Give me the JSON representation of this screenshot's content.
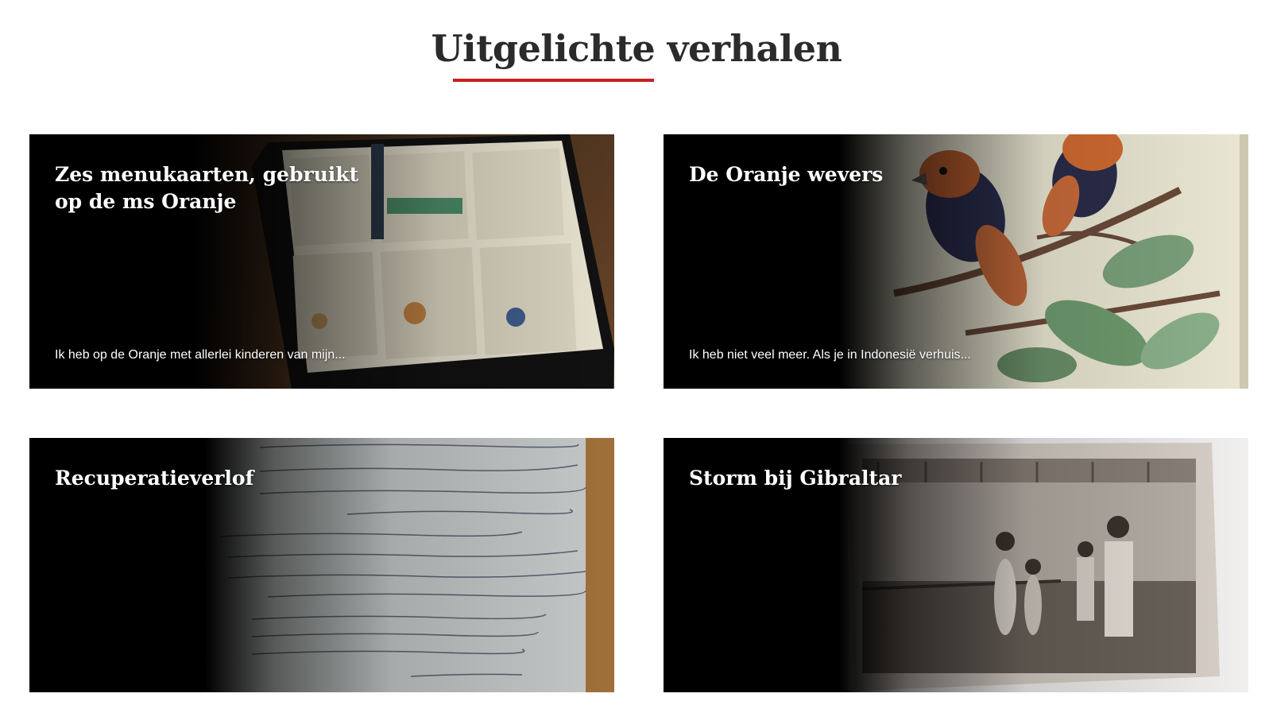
{
  "section": {
    "title": "Uitgelichte verhalen",
    "accent_color": "#c8201e"
  },
  "stories": [
    {
      "title": "Zes menukaarten, gebruikt op de ms Oranje",
      "excerpt": "Ik heb op de Oranje met allerlei kinderen van mijn..."
    },
    {
      "title": "De Oranje wevers",
      "excerpt": "Ik heb niet veel meer. Als je in Indonesië verhuis..."
    },
    {
      "title": "Recuperatieverlof",
      "excerpt": ""
    },
    {
      "title": "Storm bij Gibraltar",
      "excerpt": ""
    }
  ]
}
